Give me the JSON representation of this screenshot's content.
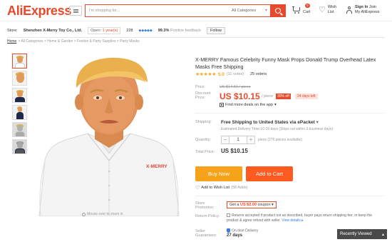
{
  "header": {
    "logo_ali": "Ali",
    "logo_express": "Express",
    "search_placeholder": "I'm shopping for...",
    "category": "All Categories",
    "cart_label": "Cart",
    "cart_count": "0",
    "wish_line1": "Wish",
    "wish_line2": "List",
    "signin_line1": "Sign In",
    "signin_join": "Join",
    "signin_line2": "My AliExpress"
  },
  "store": {
    "label": "Store:",
    "name": "Shenzhen X-Merry Toy Co., Ltd.",
    "open_prefix": "Open:",
    "open_years": "1 year(s)",
    "score": "228",
    "diamonds": "◆◆◆◆◆",
    "feedback_pct": "99.3%",
    "feedback_label": "Positive feedback",
    "follow": "Follow"
  },
  "breadcrumb": {
    "home": "Home",
    "path": "> All Categories > Home & Garden > Festive & Party Supplies > Party Masks"
  },
  "product": {
    "title": "X-MERRY Famous Celebrity Funny Mask Props Donald Trump Overhead Latex Masks Free Shipping",
    "stars": "★★★★★",
    "rating": "5.0",
    "votes": "(11 votes)",
    "orders": "25 orders",
    "price_label": "Price:",
    "old_price": "US $14.50 / piece",
    "discount_label_1": "Discount",
    "discount_label_2": "Price:",
    "price": "US $10.15",
    "per_piece": "/ piece",
    "off_tag": "30% off",
    "time_left": "24 days left",
    "app_deal": "Find more deals on the app",
    "shipping_label": "Shipping:",
    "shipping_main": "Free Shipping to United States via ePacket",
    "shipping_sub": "Estimated Delivery Time:10-15 days (Ships out within 3 business days)",
    "quantity_label": "Quantity:",
    "quantity_value": "1",
    "quantity_avail": "piece (276 pieces available)",
    "total_label": "Total Price:",
    "total": "US $10.15",
    "buy_now": "Buy Now",
    "add_to_cart": "Add to Cart",
    "wish": "Add to Wish List",
    "wish_count": "(58 Adds)",
    "zoom_hint": "Mouse over to zoom in",
    "shirt_brand": "X-MERRY"
  },
  "promo": {
    "label_1": "Store",
    "label_2": "Promotion:",
    "coupon_prefix": "Get a",
    "coupon_amount": "US $2.00",
    "coupon_suffix": "coupon"
  },
  "returns": {
    "label": "Return Policy:",
    "text": "Returns accepted if product not as described, buyer pays return shipping fee; or keep the product & agree refund with seller.",
    "link": "View details"
  },
  "guarantee": {
    "label_1": "Seller",
    "label_2": "Guarantees:",
    "line1": "On-time Delivery",
    "line2": "27 days"
  },
  "recently_viewed": "Recently Viewed"
}
